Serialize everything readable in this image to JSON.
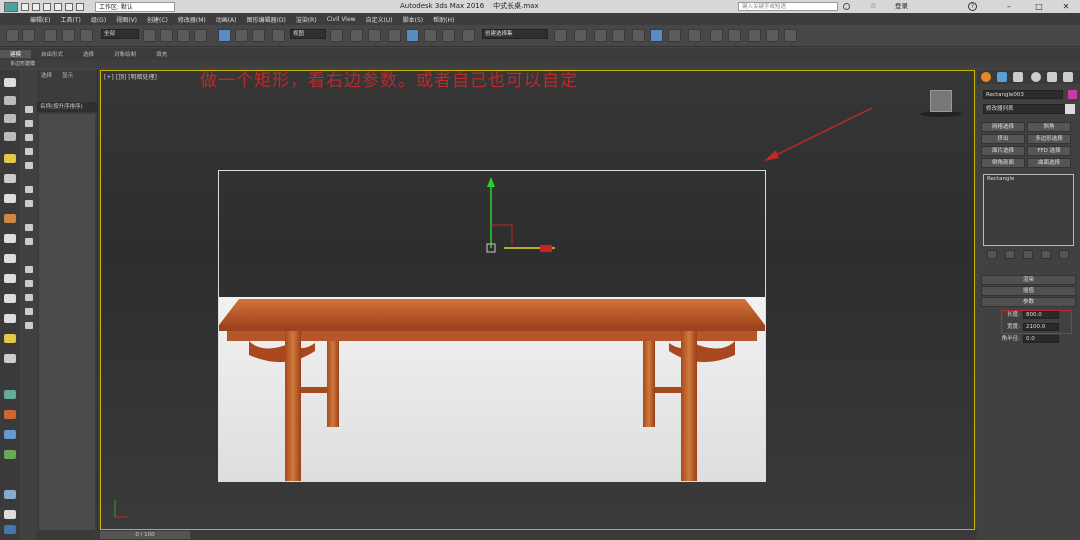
{
  "titlebar": {
    "workspace_label": "工作区: 默认",
    "app_title": "Autodesk 3ds Max 2016",
    "file_name": "中式长桌.max",
    "search_placeholder": "键入关键字或短语",
    "user_label": "登录"
  },
  "menu": [
    "编辑(E)",
    "工具(T)",
    "组(G)",
    "视图(V)",
    "创建(C)",
    "修改器(M)",
    "动画(A)",
    "图形编辑器(D)",
    "渲染(R)",
    "Civil View",
    "自定义(U)",
    "脚本(S)",
    "帮助(H)"
  ],
  "toolbar": {
    "selection_filter": "全部",
    "ref_coord": "视图",
    "named_selection": "创建选择集"
  },
  "ribbon": {
    "tabs": [
      "建模",
      "自由形式",
      "选择",
      "对象绘制",
      "填充"
    ],
    "active_tab": "建模",
    "sub_label": "多边形建模"
  },
  "explorer": {
    "tabs": [
      "选择",
      "显示"
    ],
    "header": "名称(按升序排序)"
  },
  "viewport": {
    "label": "[+] [顶] [明暗处理]",
    "instruction": "做一个矩形，看右边参数。或者自己也可以自定",
    "time_label": "0 / 100"
  },
  "command_panel": {
    "object_name": "Rectangle003",
    "object_color": "#c93aa5",
    "modifier_list": "修改器列表",
    "buttons": [
      "网格选择",
      "斜角",
      "挤出",
      "多边形选择",
      "面片选择",
      "FFD 选择",
      "倒角剖面",
      "曲面选择"
    ],
    "stack_item": "Rectangle",
    "rollouts": [
      "渲染",
      "插值",
      "参数"
    ],
    "params": [
      {
        "label": "长度:",
        "value": "800.0"
      },
      {
        "label": "宽度:",
        "value": "2100.0"
      },
      {
        "label": "角半径:",
        "value": "0.0"
      }
    ]
  },
  "colors": {
    "annotation_red": "#c0282a",
    "viewport_border": "#c8b400",
    "active_blue": "#5a8cc4"
  }
}
